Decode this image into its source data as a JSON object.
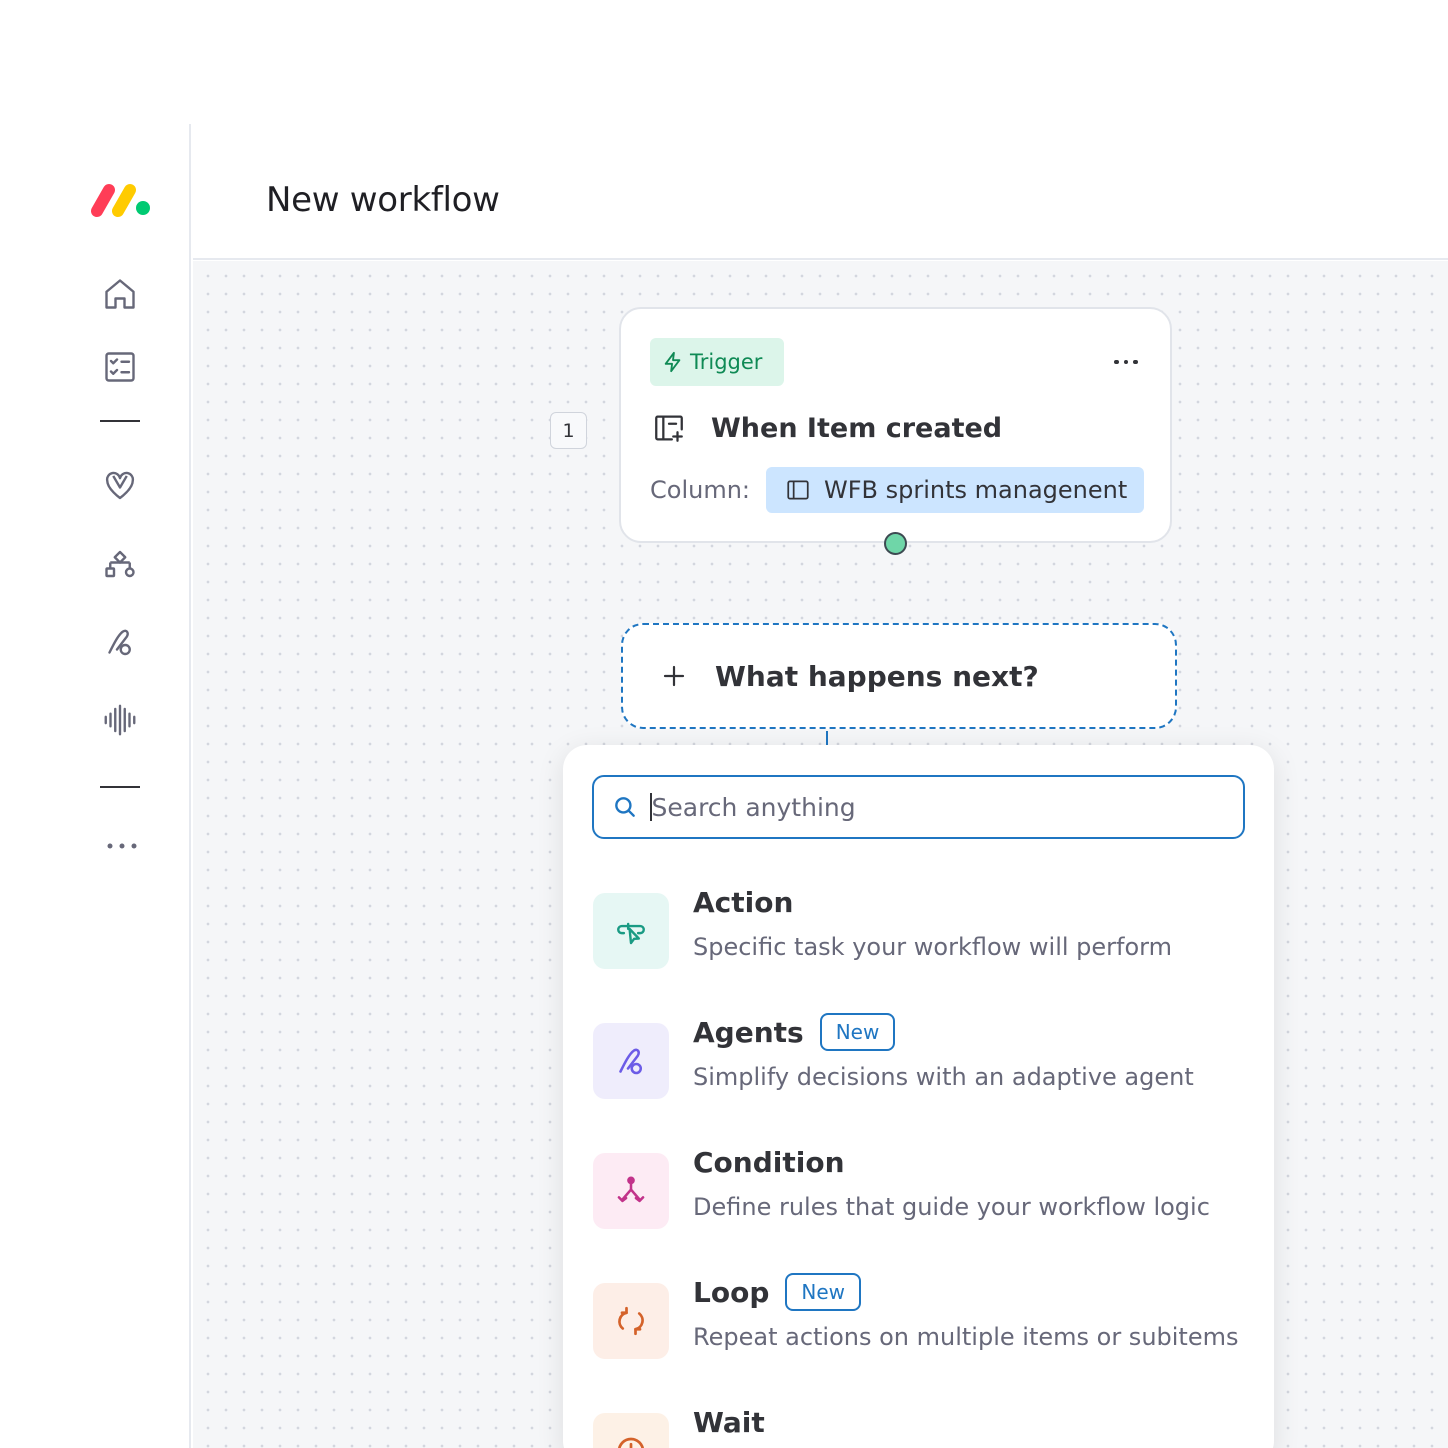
{
  "header": {
    "title": "New workflow"
  },
  "sidebar": {
    "icons": [
      "home-icon",
      "tasks-icon",
      "heart-icon",
      "apps-icon",
      "agents-icon",
      "voice-icon",
      "more-icon"
    ]
  },
  "workflow": {
    "step_number": "1",
    "trigger": {
      "badge": "Trigger",
      "title": "When Item created",
      "column_label": "Column:",
      "column_value": "WFB sprints managenent"
    },
    "next": {
      "label": "What happens next?"
    }
  },
  "menu": {
    "search_placeholder": "Search anything",
    "items": [
      {
        "title": "Action",
        "desc": "Specific task your workflow will perform",
        "badge": "",
        "icon": "action-icon",
        "icon_bg": "#e6f7f4",
        "icon_color": "#1a9b84"
      },
      {
        "title": "Agents",
        "desc": "Simplify decisions with an adaptive agent",
        "badge": "New",
        "icon": "agents-icon",
        "icon_bg": "#efedfc",
        "icon_color": "#6c5ce7"
      },
      {
        "title": "Condition",
        "desc": "Define rules that guide your workflow logic",
        "badge": "",
        "icon": "condition-icon",
        "icon_bg": "#fdebf4",
        "icon_color": "#c2338a"
      },
      {
        "title": "Loop",
        "desc": "Repeat actions on multiple items or subitems",
        "badge": "New",
        "icon": "loop-icon",
        "icon_bg": "#fdeee7",
        "icon_color": "#d4622a"
      },
      {
        "title": "Wait",
        "desc": "",
        "badge": "",
        "icon": "clock-icon",
        "icon_bg": "#fdf1e6",
        "icon_color": "#d4622a"
      }
    ]
  },
  "colors": {
    "accent": "#1f76c2",
    "trigger_green": "#0f8a55",
    "chip_blue": "#cce5ff"
  }
}
